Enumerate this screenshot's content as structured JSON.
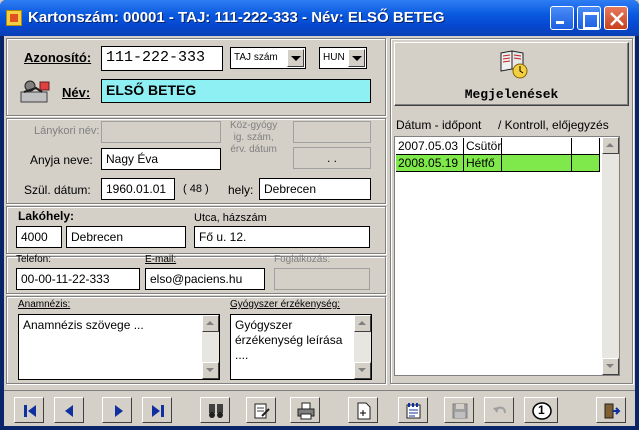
{
  "window": {
    "title": "Kartonszám: 00001  -  TAJ: 111-222-333  -  Név: ELSŐ BETEG"
  },
  "patient": {
    "id_label": "Azonosító:",
    "id_value": "111-222-333",
    "id_type": "TAJ szám",
    "country": "HUN",
    "name_label": "Név:",
    "name_value": "ELSŐ BETEG",
    "maiden_label": "Lánykori név:",
    "maiden_value": "",
    "mother_label": "Anyja neve:",
    "mother_value": "Nagy Éva",
    "birth_label": "Szül. dátum:",
    "birth_value": "1960.01.01",
    "age": "( 48 )",
    "place_label": "hely:",
    "place_value": "Debrecen",
    "kozgyogy_label": "Köz-gyógy\nig. szám,\nérv. dátum",
    "kozgyogy_number": "",
    "kozgyogy_date": ". ."
  },
  "address": {
    "residence_label": "Lakóhely:",
    "zip": "4000",
    "city": "Debrecen",
    "street_label": "Utca, házszám",
    "street": "Fő u. 12."
  },
  "contact": {
    "phone_label": "Telefon:",
    "phone": "00-00-11-22-333",
    "email_label": "E-mail:",
    "email": "elso@paciens.hu",
    "job_label": "Foglalkozás:",
    "job": ""
  },
  "notes": {
    "anamnesis_label": "Anamnézis:",
    "anamnesis_text": "Anamnézis szövege ...",
    "allergy_label": "Gyógyszer érzékenység:",
    "allergy_text": "Gyógyszer\nérzékenység leírása\n...."
  },
  "appointments": {
    "button_label": "Megjelenések",
    "col_date": "Dátum - időpont",
    "col_control": "/ Kontroll, előjegyzés",
    "rows": [
      {
        "date": "2007.05.03",
        "day": "Csütör",
        "selected": false
      },
      {
        "date": "2008.05.19",
        "day": "Hétfő",
        "selected": true
      }
    ],
    "selected_color": "#7fe84a"
  },
  "toolbar": {
    "buttons": [
      "first-record",
      "prev-record",
      "next-record",
      "last-record",
      "search",
      "edit",
      "print",
      "new",
      "notes",
      "save",
      "undo",
      "info",
      "exit"
    ],
    "info_label": "1"
  },
  "colors": {
    "titlebar": "#0a5ae0",
    "name_field": "#8ff0f4",
    "nav_arrow": "#1030a0"
  }
}
